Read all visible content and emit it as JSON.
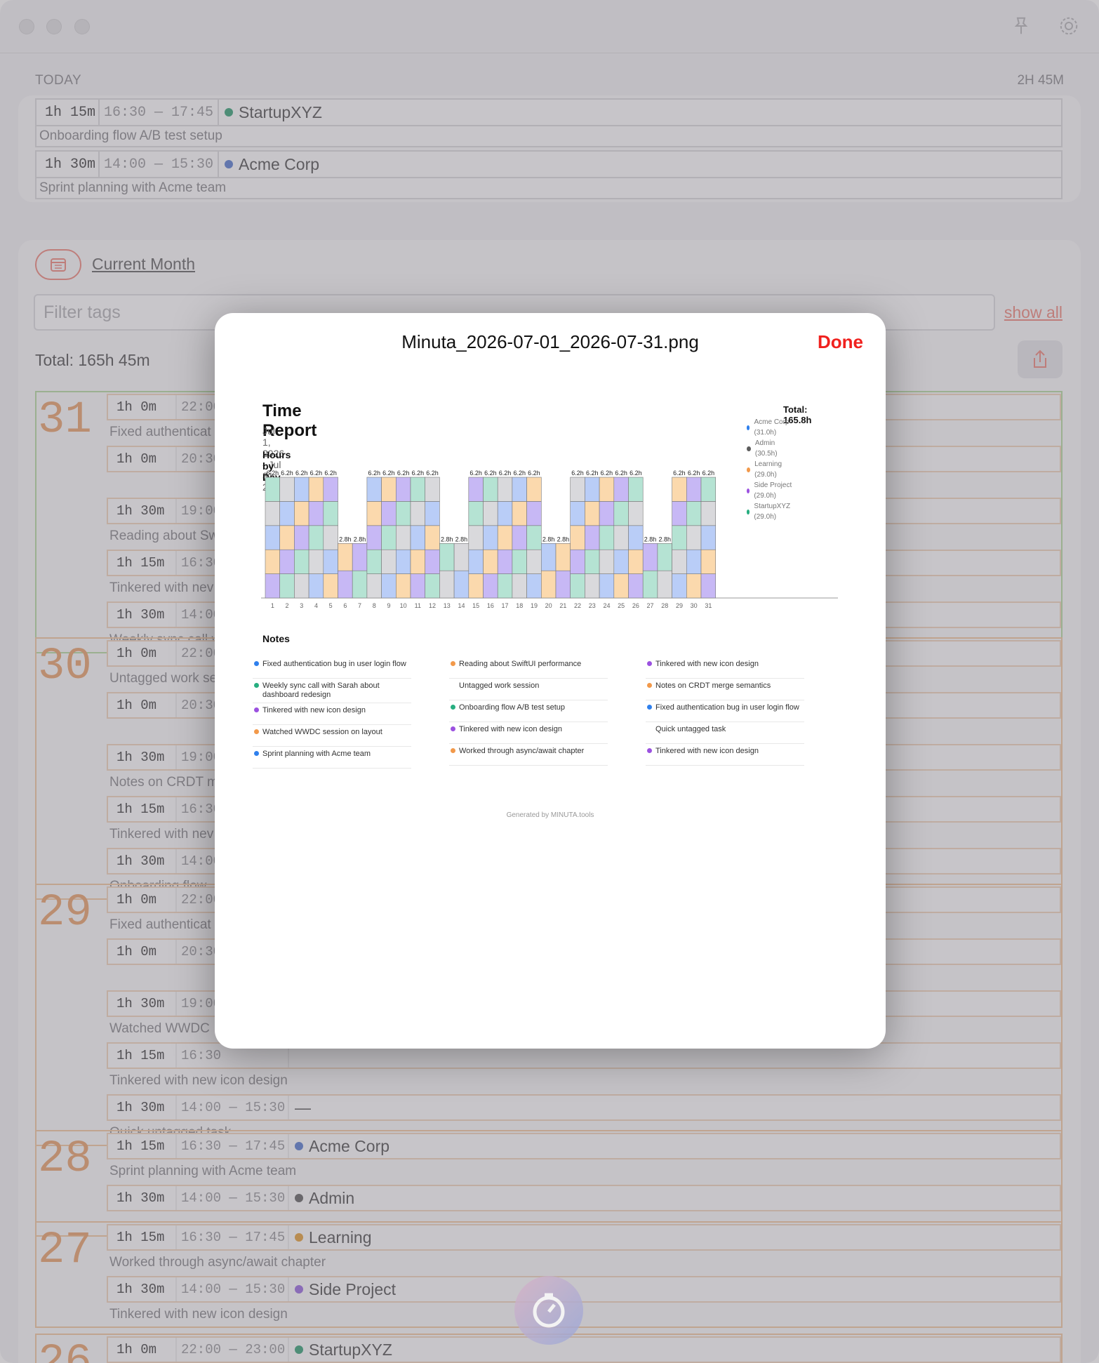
{
  "today": {
    "label": "TODAY",
    "total": "2H 45M",
    "entries": [
      {
        "duration": "1h 15m",
        "range": "16:30 — 17:45",
        "tag": "StartupXYZ",
        "tag_color": "#3aa37a",
        "note": "Onboarding flow A/B test setup"
      },
      {
        "duration": "1h 30m",
        "range": "14:00 — 15:30",
        "tag": "Acme Corp",
        "tag_color": "#5b7fd0",
        "note": "Sprint planning with Acme team"
      }
    ]
  },
  "filters": {
    "period_label": "Current Month",
    "filter_placeholder": "Filter tags",
    "show_all_label": "show all",
    "total_label": "Total: 165h 45m"
  },
  "days": [
    {
      "day": "31",
      "entries": [
        {
          "duration": "1h 0m",
          "range": "22:00",
          "note": "Fixed authenticat"
        },
        {
          "duration": "1h 0m",
          "range": "20:30",
          "note": ""
        },
        {
          "duration": "1h 30m",
          "range": "19:00",
          "note": "Reading about Sw"
        },
        {
          "duration": "1h 15m",
          "range": "16:30",
          "note": "Tinkered with nev"
        },
        {
          "duration": "1h 30m",
          "range": "14:00",
          "note": "Weekly sync call v"
        }
      ]
    },
    {
      "day": "30",
      "entries": [
        {
          "duration": "1h 0m",
          "range": "22:00",
          "note": "Untagged work se"
        },
        {
          "duration": "1h 0m",
          "range": "20:30",
          "note": ""
        },
        {
          "duration": "1h 30m",
          "range": "19:00",
          "note": "Notes on CRDT m"
        },
        {
          "duration": "1h 15m",
          "range": "16:30",
          "note": "Tinkered with nev"
        },
        {
          "duration": "1h 30m",
          "range": "14:00",
          "note": "Onboarding flow"
        }
      ]
    },
    {
      "day": "29",
      "entries": [
        {
          "duration": "1h 0m",
          "range": "22:00",
          "note": "Fixed authenticat"
        },
        {
          "duration": "1h 0m",
          "range": "20:30",
          "note": ""
        },
        {
          "duration": "1h 30m",
          "range": "19:00",
          "note": "Watched WWDC"
        },
        {
          "duration": "1h 15m",
          "range": "16:30",
          "note": "Tinkered with new icon design"
        },
        {
          "duration": "1h 30m",
          "range": "14:00 — 15:30",
          "tag": "—",
          "note": "Quick untagged task"
        }
      ]
    },
    {
      "day": "28",
      "entries": [
        {
          "duration": "1h 15m",
          "range": "16:30 — 17:45",
          "tag": "Acme Corp",
          "tag_color": "#5b7fd0",
          "note": "Sprint planning with Acme team"
        },
        {
          "duration": "1h 30m",
          "range": "14:00 — 15:30",
          "tag": "Admin",
          "tag_color": "#666666",
          "note": ""
        }
      ]
    },
    {
      "day": "27",
      "entries": [
        {
          "duration": "1h 15m",
          "range": "16:30 — 17:45",
          "tag": "Learning",
          "tag_color": "#e6a23c",
          "note": "Worked through async/await chapter"
        },
        {
          "duration": "1h 30m",
          "range": "14:00 — 15:30",
          "tag": "Side Project",
          "tag_color": "#9b6ee0",
          "note": "Tinkered with new icon design"
        }
      ]
    },
    {
      "day": "26",
      "entries": [
        {
          "duration": "1h 0m",
          "range": "22:00 — 23:00",
          "tag": "StartupXYZ",
          "tag_color": "#3aa37a",
          "note": ""
        }
      ]
    }
  ],
  "modal": {
    "title": "Minuta_2026-07-01_2026-07-31.png",
    "done_label": "Done"
  },
  "report": {
    "title": "Time Report",
    "date_range": "Jul 1, 2026 - Jul 31, 2026",
    "total": "Total: 165.8h",
    "legend": [
      {
        "label": "Acme Corp (31.0h)",
        "color": "#2f80ed"
      },
      {
        "label": "Admin (30.5h)",
        "color": "#5c5c5c"
      },
      {
        "label": "Learning (29.0h)",
        "color": "#f2994a"
      },
      {
        "label": "Side Project (29.0h)",
        "color": "#9b51e0"
      },
      {
        "label": "StartupXYZ (29.0h)",
        "color": "#27ae80"
      }
    ],
    "chart_heading": "Hours by Day",
    "notes_heading": "Notes",
    "notes": [
      [
        {
          "text": "Fixed authentication bug in user login flow",
          "color": "#2f80ed"
        },
        {
          "text": "Weekly sync call with Sarah about dashboard redesign",
          "color": "#27ae80"
        },
        {
          "text": "Tinkered with new icon design",
          "color": "#9b51e0"
        },
        {
          "text": "Watched WWDC session on layout",
          "color": "#f2994a"
        },
        {
          "text": "Sprint planning with Acme team",
          "color": "#2f80ed"
        }
      ],
      [
        {
          "text": "Reading about SwiftUI performance",
          "color": "#f2994a"
        },
        {
          "text": "Untagged work session",
          "color": ""
        },
        {
          "text": "Onboarding flow A/B test setup",
          "color": "#27ae80"
        },
        {
          "text": "Tinkered with new icon design",
          "color": "#9b51e0"
        },
        {
          "text": "Worked through async/await chapter",
          "color": "#f2994a"
        }
      ],
      [
        {
          "text": "Tinkered with new icon design",
          "color": "#9b51e0"
        },
        {
          "text": "Notes on CRDT merge semantics",
          "color": "#f2994a"
        },
        {
          "text": "Fixed authentication bug in user login flow",
          "color": "#2f80ed"
        },
        {
          "text": "Quick untagged task",
          "color": ""
        },
        {
          "text": "Tinkered with new icon design",
          "color": "#9b51e0"
        }
      ]
    ],
    "footer": "Generated by MINUTA.tools"
  },
  "chart_data": {
    "type": "bar",
    "title": "Hours by Day",
    "categories": [
      "1",
      "2",
      "3",
      "4",
      "5",
      "6",
      "7",
      "8",
      "9",
      "10",
      "11",
      "12",
      "13",
      "14",
      "15",
      "16",
      "17",
      "18",
      "19",
      "20",
      "21",
      "22",
      "23",
      "24",
      "25",
      "26",
      "27",
      "28",
      "29",
      "30",
      "31"
    ],
    "values": [
      6.2,
      6.2,
      6.2,
      6.2,
      6.2,
      2.8,
      2.8,
      6.2,
      6.2,
      6.2,
      6.2,
      6.2,
      2.8,
      2.8,
      6.2,
      6.2,
      6.2,
      6.2,
      6.2,
      2.8,
      2.8,
      6.2,
      6.2,
      6.2,
      6.2,
      6.2,
      2.8,
      2.8,
      6.2,
      6.2,
      6.2
    ],
    "value_labels": [
      "6.2h",
      "6.2h",
      "6.2h",
      "6.2h",
      "6.2h",
      "2.8h",
      "2.8h",
      "6.2h",
      "6.2h",
      "6.2h",
      "6.2h",
      "6.2h",
      "2.8h",
      "2.8h",
      "6.2h",
      "6.2h",
      "6.2h",
      "6.2h",
      "6.2h",
      "2.8h",
      "2.8h",
      "6.2h",
      "6.2h",
      "6.2h",
      "6.2h",
      "6.2h",
      "2.8h",
      "2.8h",
      "6.2h",
      "6.2h",
      "6.2h"
    ],
    "stacked": true,
    "segment_colors": [
      "#c7b8f5",
      "#b9cdf7",
      "#b5e3d3",
      "#fbd9ad",
      "#d9d9dc"
    ],
    "ylim": [
      0,
      6.2
    ]
  }
}
